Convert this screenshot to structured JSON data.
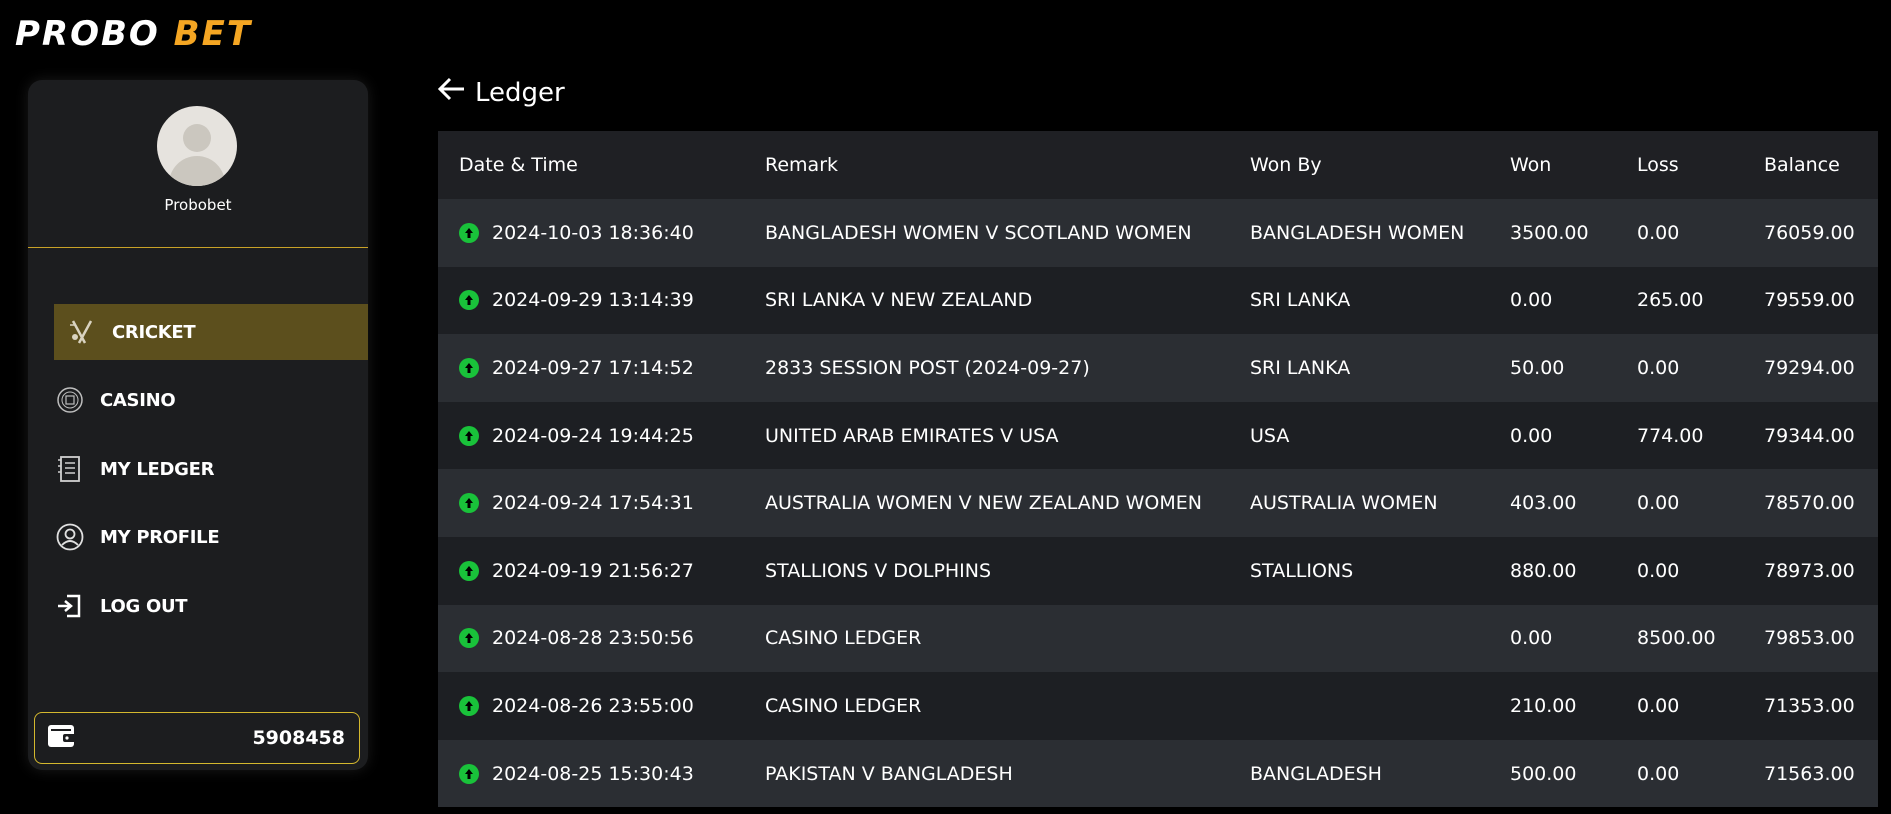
{
  "brand": {
    "part1": "PROBO",
    "part2": "BET",
    "accent": "#f5a623"
  },
  "sidebar": {
    "username": "Probobet",
    "items": [
      {
        "label": "CRICKET",
        "icon": "cricket-icon",
        "active": true
      },
      {
        "label": "CASINO",
        "icon": "casino-chip-icon",
        "active": false
      },
      {
        "label": "MY LEDGER",
        "icon": "ledger-icon",
        "active": false
      },
      {
        "label": "MY PROFILE",
        "icon": "user-icon",
        "active": false
      },
      {
        "label": "LOG OUT",
        "icon": "logout-icon",
        "active": false
      }
    ],
    "wallet": {
      "icon": "wallet-icon",
      "amount": "5908458"
    }
  },
  "page": {
    "back_icon": "arrow-left-icon",
    "title": "Ledger"
  },
  "ledger": {
    "columns": [
      "Date & Time",
      "Remark",
      "Won By",
      "Won",
      "Loss",
      "Balance"
    ],
    "rows": [
      {
        "datetime": "2024-10-03 18:36:40",
        "remark": "BANGLADESH WOMEN V SCOTLAND WOMEN",
        "won_by": "BANGLADESH WOMEN",
        "won": "3500.00",
        "loss": "0.00",
        "balance": "76059.00"
      },
      {
        "datetime": "2024-09-29 13:14:39",
        "remark": "SRI LANKA V NEW ZEALAND",
        "won_by": "SRI LANKA",
        "won": "0.00",
        "loss": "265.00",
        "balance": "79559.00"
      },
      {
        "datetime": "2024-09-27 17:14:52",
        "remark": "2833 SESSION POST (2024-09-27)",
        "won_by": "SRI LANKA",
        "won": "50.00",
        "loss": "0.00",
        "balance": "79294.00"
      },
      {
        "datetime": "2024-09-24 19:44:25",
        "remark": "UNITED ARAB EMIRATES V USA",
        "won_by": "USA",
        "won": "0.00",
        "loss": "774.00",
        "balance": "79344.00"
      },
      {
        "datetime": "2024-09-24 17:54:31",
        "remark": "AUSTRALIA WOMEN V NEW ZEALAND WOMEN",
        "won_by": "AUSTRALIA WOMEN",
        "won": "403.00",
        "loss": "0.00",
        "balance": "78570.00"
      },
      {
        "datetime": "2024-09-19 21:56:27",
        "remark": "STALLIONS V DOLPHINS",
        "won_by": "STALLIONS",
        "won": "880.00",
        "loss": "0.00",
        "balance": "78973.00"
      },
      {
        "datetime": "2024-08-28 23:50:56",
        "remark": "CASINO LEDGER",
        "won_by": "",
        "won": "0.00",
        "loss": "8500.00",
        "balance": "79853.00"
      },
      {
        "datetime": "2024-08-26 23:55:00",
        "remark": "CASINO LEDGER",
        "won_by": "",
        "won": "210.00",
        "loss": "0.00",
        "balance": "71353.00"
      },
      {
        "datetime": "2024-08-25 15:30:43",
        "remark": "PAKISTAN V BANGLADESH",
        "won_by": "BANGLADESH",
        "won": "500.00",
        "loss": "0.00",
        "balance": "71563.00"
      }
    ],
    "row_icon": "arrow-up-circle-icon",
    "row_icon_color": "#19c23a"
  }
}
